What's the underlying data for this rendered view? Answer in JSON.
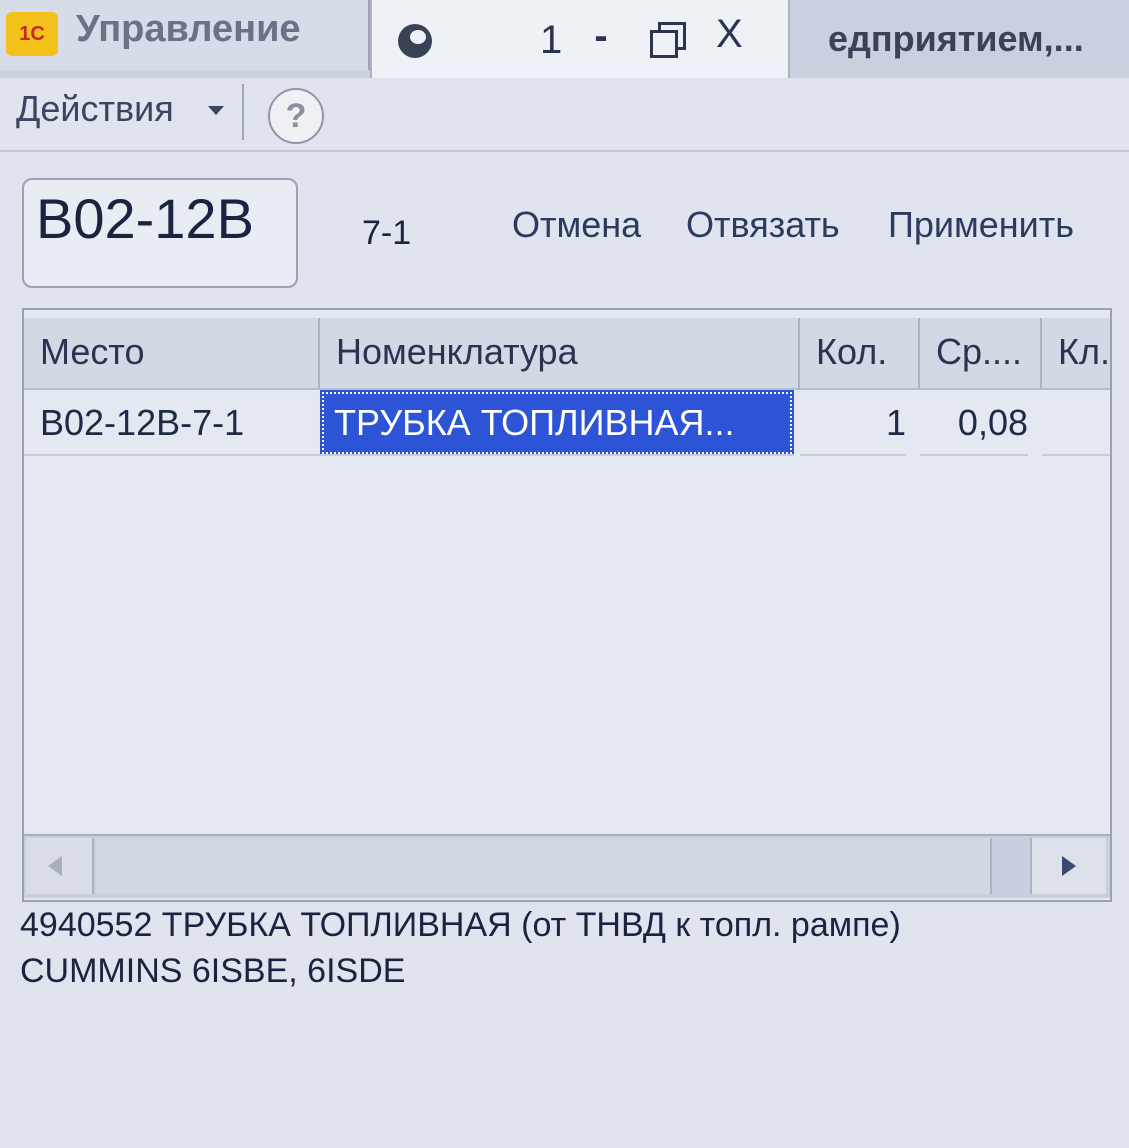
{
  "window": {
    "app_logo": "1С",
    "left_tab_title": "Управление",
    "tab_number": "1",
    "minimize_glyph": "-",
    "close_glyph": "X",
    "right_tab_title": "едприятием,...",
    "tab_icon": "refresh-icon"
  },
  "toolbar": {
    "actions_label": "Действия",
    "help_label": "?"
  },
  "form": {
    "place_code": "B02-12B",
    "cell_code": "7-1",
    "cancel_label": "Отмена",
    "unbind_label": "Отвязать",
    "apply_label": "Применить"
  },
  "table": {
    "columns": [
      "Место",
      "Номенклатура",
      "Кол.",
      "Ср....",
      "Кл."
    ],
    "rows": [
      {
        "place": "B02-12B-7-1",
        "nomenclature": "ТРУБКА ТОПЛИВНАЯ...",
        "qty": "1",
        "avg": "0,08",
        "kl": ""
      }
    ]
  },
  "description": "4940552 ТРУБКА ТОПЛИВНАЯ (от ТНВД к топл. рампе)\nCUMMINS 6ISBE, 6ISDE",
  "colors": {
    "selection": "#2d54d6",
    "background": "#dfe4ee"
  }
}
